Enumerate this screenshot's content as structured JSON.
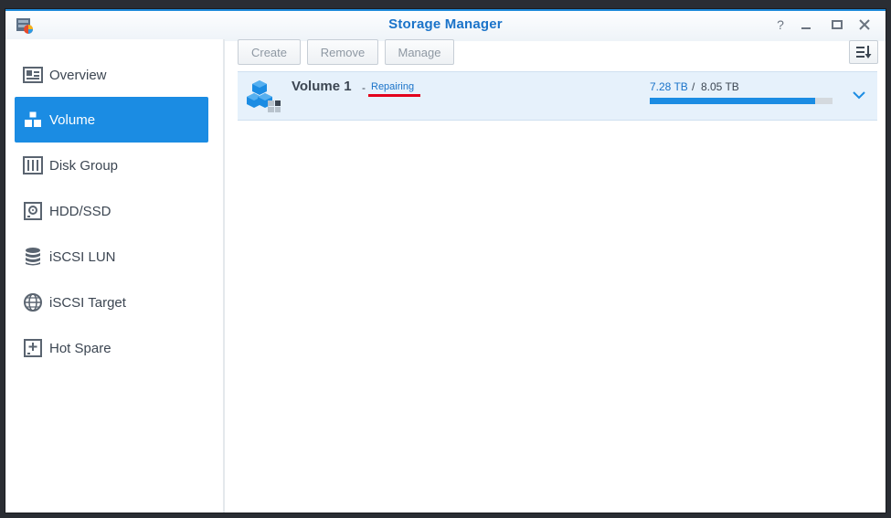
{
  "window": {
    "title": "Storage Manager",
    "controls": {
      "help": "?",
      "minimize": "–",
      "maximize": "□",
      "close": "×"
    }
  },
  "sidebar": {
    "items": [
      {
        "label": "Overview",
        "icon": "overview-icon",
        "active": false
      },
      {
        "label": "Volume",
        "icon": "volume-cubes-icon",
        "active": true
      },
      {
        "label": "Disk Group",
        "icon": "disk-group-icon",
        "active": false
      },
      {
        "label": "HDD/SSD",
        "icon": "hdd-icon",
        "active": false
      },
      {
        "label": "iSCSI LUN",
        "icon": "database-icon",
        "active": false
      },
      {
        "label": "iSCSI Target",
        "icon": "globe-icon",
        "active": false
      },
      {
        "label": "Hot Spare",
        "icon": "hot-spare-plus-icon",
        "active": false
      }
    ]
  },
  "toolbar": {
    "create_label": "Create",
    "remove_label": "Remove",
    "manage_label": "Manage",
    "sort_icon": "sort-icon"
  },
  "volume": {
    "name": "Volume 1",
    "separator": "-",
    "status": "Repairing",
    "used": "7.28 TB",
    "slash": "/",
    "total": "8.05 TB",
    "usage_fraction": 0.904
  },
  "colors": {
    "accent": "#1b8ce3",
    "title": "#1a73c9",
    "annotation_underline": "#e3001b",
    "row_bg": "#e6f1fb"
  }
}
